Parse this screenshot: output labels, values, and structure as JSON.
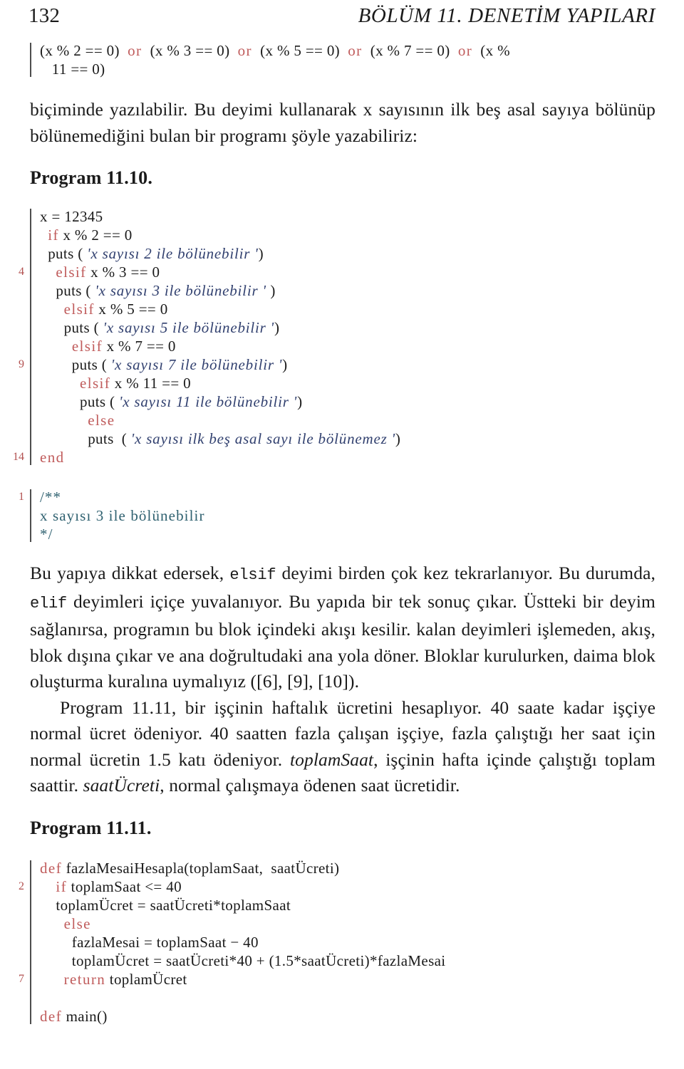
{
  "header": {
    "folio": "132",
    "running_title": "BÖLÜM 11.  DENETİM YAPILARI"
  },
  "listing_top": {
    "lines": [
      {
        "num": "",
        "segments": [
          {
            "t": "(x % 2 == 0)  ",
            "c": "pln"
          },
          {
            "t": "or",
            "c": "kw"
          },
          {
            "t": "  (x % 3 == 0)  ",
            "c": "pln"
          },
          {
            "t": "or",
            "c": "kw"
          },
          {
            "t": "  (x % 5 == 0)  ",
            "c": "pln"
          },
          {
            "t": "or",
            "c": "kw"
          },
          {
            "t": "  (x % 7 == 0)  ",
            "c": "pln"
          },
          {
            "t": "or",
            "c": "kw"
          },
          {
            "t": "  (x %",
            "c": "pln"
          }
        ]
      },
      {
        "num": "",
        "segments": [
          {
            "t": "   11 == 0)",
            "c": "pln"
          }
        ]
      }
    ]
  },
  "para_intro": {
    "text": "biçiminde yazılabilir. Bu deyimi kullanarak x sayısının ilk beş asal sayıya bölünüp bölünemediğini bulan bir programı şöyle yazabiliriz:"
  },
  "caption_1110": "Program 11.10.",
  "listing_1110": {
    "lines": [
      {
        "num": "",
        "segments": [
          {
            "t": "x = 12345",
            "c": "pln"
          }
        ]
      },
      {
        "num": "",
        "segments": [
          {
            "t": "  ",
            "c": "pln"
          },
          {
            "t": "if",
            "c": "kw"
          },
          {
            "t": " x % 2 == 0",
            "c": "pln"
          }
        ]
      },
      {
        "num": "",
        "segments": [
          {
            "t": "  puts ( ",
            "c": "pln"
          },
          {
            "t": "'x sayısı 2 ile bölünebilir '",
            "c": "str"
          },
          {
            "t": ")",
            "c": "pln"
          }
        ]
      },
      {
        "num": "4",
        "segments": [
          {
            "t": "    ",
            "c": "pln"
          },
          {
            "t": "elsif",
            "c": "kw"
          },
          {
            "t": " x % 3 == 0",
            "c": "pln"
          }
        ]
      },
      {
        "num": "",
        "segments": [
          {
            "t": "    puts ( ",
            "c": "pln"
          },
          {
            "t": "'x sayısı 3 ile bölünebilir '",
            "c": "str"
          },
          {
            "t": " )",
            "c": "pln"
          }
        ]
      },
      {
        "num": "",
        "segments": [
          {
            "t": "      ",
            "c": "pln"
          },
          {
            "t": "elsif",
            "c": "kw"
          },
          {
            "t": " x % 5 == 0",
            "c": "pln"
          }
        ]
      },
      {
        "num": "",
        "segments": [
          {
            "t": "      puts ( ",
            "c": "pln"
          },
          {
            "t": "'x sayısı 5 ile bölünebilir '",
            "c": "str"
          },
          {
            "t": ")",
            "c": "pln"
          }
        ]
      },
      {
        "num": "",
        "segments": [
          {
            "t": "        ",
            "c": "pln"
          },
          {
            "t": "elsif",
            "c": "kw"
          },
          {
            "t": " x % 7 == 0",
            "c": "pln"
          }
        ]
      },
      {
        "num": "9",
        "segments": [
          {
            "t": "        puts ( ",
            "c": "pln"
          },
          {
            "t": "'x sayısı 7 ile bölünebilir '",
            "c": "str"
          },
          {
            "t": ")",
            "c": "pln"
          }
        ]
      },
      {
        "num": "",
        "segments": [
          {
            "t": "          ",
            "c": "pln"
          },
          {
            "t": "elsif",
            "c": "kw"
          },
          {
            "t": " x % 11 == 0",
            "c": "pln"
          }
        ]
      },
      {
        "num": "",
        "segments": [
          {
            "t": "          puts ( ",
            "c": "pln"
          },
          {
            "t": "'x sayısı 11 ile bölünebilir '",
            "c": "str"
          },
          {
            "t": ")",
            "c": "pln"
          }
        ]
      },
      {
        "num": "",
        "segments": [
          {
            "t": "            ",
            "c": "pln"
          },
          {
            "t": "else",
            "c": "kw"
          }
        ]
      },
      {
        "num": "",
        "segments": [
          {
            "t": "            puts  ( ",
            "c": "pln"
          },
          {
            "t": "'x sayısı ilk beş asal sayı ile bölünemez '",
            "c": "str"
          },
          {
            "t": ")",
            "c": "pln"
          }
        ]
      },
      {
        "num": "14",
        "segments": [
          {
            "t": "end",
            "c": "kw"
          }
        ]
      }
    ]
  },
  "listing_comment": {
    "lines": [
      {
        "num": "1",
        "segments": [
          {
            "t": "/**",
            "c": "cmt"
          }
        ]
      },
      {
        "num": "",
        "segments": [
          {
            "t": "x sayısı 3 ile bölünebilir",
            "c": "cmt"
          }
        ]
      },
      {
        "num": "",
        "segments": [
          {
            "t": "*/",
            "c": "cmt"
          }
        ]
      }
    ]
  },
  "para_elsif": {
    "prefix": "Bu yapıya dikkat edersek, ",
    "code1": "elsif",
    "mid1": " deyimi birden çok kez tekrarlanıyor. Bu durumda, ",
    "code2": "elif",
    "mid2": " deyimleri içiçe yuvalanıyor. Bu yapıda bir tek sonuç çıkar. Üstteki bir deyim sağlanırsa, programın bu blok içindeki akışı kesilir. kalan deyimleri işlemeden, akış, blok dışına çıkar ve ana doğrultudaki ana yola döner. Bloklar kurulurken, daima blok oluşturma kuralına uymalıyız ([6], [9], [10])."
  },
  "para_ucret": {
    "p1": "Program 11.11, bir işçinin haftalık ücretini hesaplıyor. 40 saate kadar işçiye normal ücret ödeniyor. 40 saatten fazla çalışan işçiye, fazla çalıştığı her saat için normal ücretin 1.5 katı ödeniyor. ",
    "ital1": "toplamSaat",
    "p2": ", işçinin hafta içinde çalıştığı toplam saattir. ",
    "ital2": "saatÜcreti",
    "p3": ", normal çalışmaya ödenen saat ücretidir."
  },
  "caption_1111": "Program 11.11.",
  "listing_1111": {
    "lines": [
      {
        "num": "",
        "segments": [
          {
            "t": "def",
            "c": "kw"
          },
          {
            "t": " fazlaMesaiHesapla(toplamSaat,  saatÜcreti)",
            "c": "pln"
          }
        ]
      },
      {
        "num": "2",
        "segments": [
          {
            "t": "    ",
            "c": "pln"
          },
          {
            "t": "if",
            "c": "kw"
          },
          {
            "t": " toplamSaat <= 40",
            "c": "pln"
          }
        ]
      },
      {
        "num": "",
        "segments": [
          {
            "t": "    toplamÜcret = saatÜcreti*toplamSaat",
            "c": "pln"
          }
        ]
      },
      {
        "num": "",
        "segments": [
          {
            "t": "      ",
            "c": "pln"
          },
          {
            "t": "else",
            "c": "kw"
          }
        ]
      },
      {
        "num": "",
        "segments": [
          {
            "t": "        fazlaMesai = toplamSaat − 40",
            "c": "pln"
          }
        ]
      },
      {
        "num": "",
        "segments": [
          {
            "t": "        toplamÜcret = saatÜcreti*40 + (1.5*saatÜcreti)*fazlaMesai",
            "c": "pln"
          }
        ]
      },
      {
        "num": "7",
        "segments": [
          {
            "t": "      ",
            "c": "pln"
          },
          {
            "t": "return",
            "c": "kw"
          },
          {
            "t": " toplamÜcret",
            "c": "pln"
          }
        ]
      },
      {
        "num": "",
        "segments": [
          {
            "t": " ",
            "c": "pln"
          }
        ]
      },
      {
        "num": "",
        "segments": [
          {
            "t": "def",
            "c": "kw"
          },
          {
            "t": " main()",
            "c": "pln"
          }
        ]
      }
    ]
  },
  "colors": {
    "keyword": "#c05c5c",
    "string": "#31406f",
    "comment": "#2f6170",
    "linenumber": "#b2504f",
    "rule": "#4d4d4d",
    "text": "#1a1a1a"
  }
}
